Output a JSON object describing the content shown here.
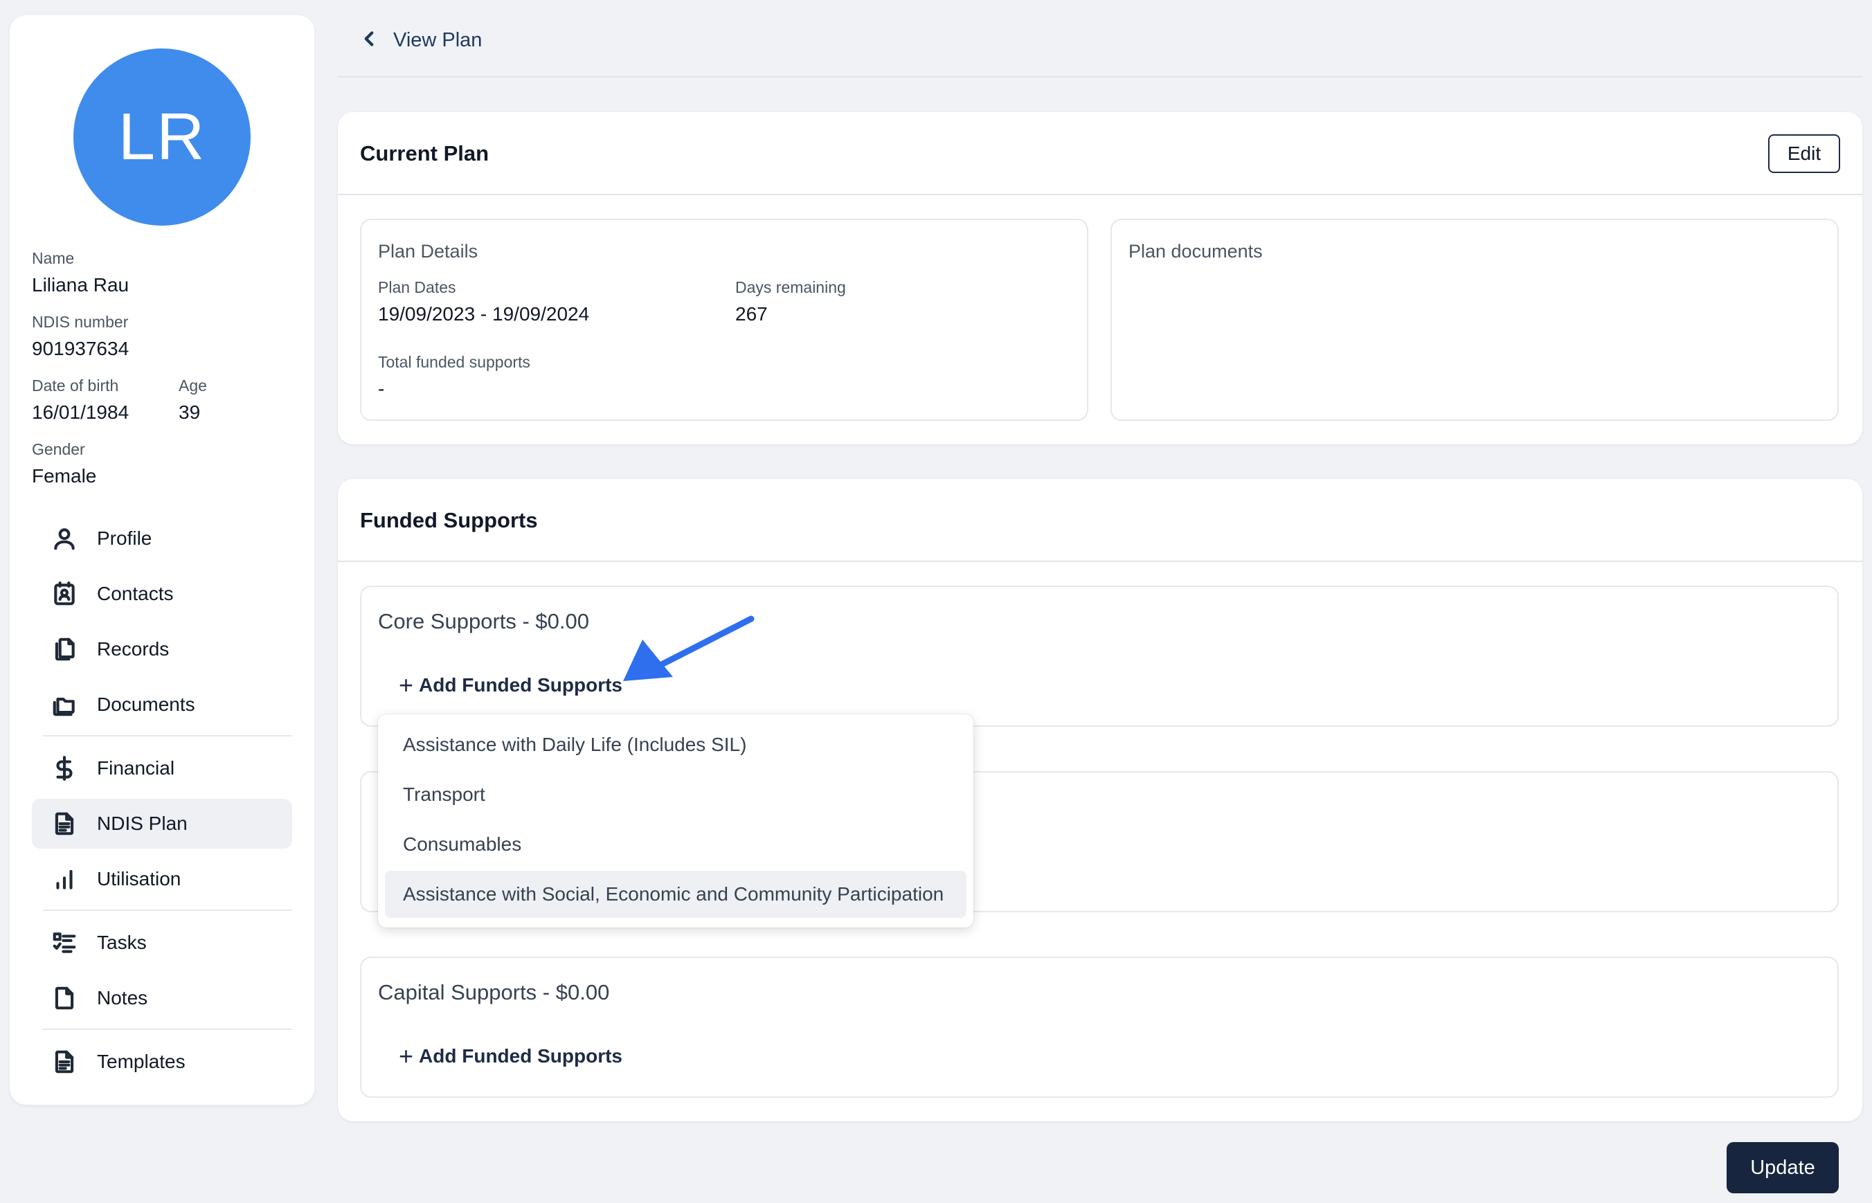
{
  "profile": {
    "initials": "LR",
    "avatar_color": "#3f8cec",
    "name_label": "Name",
    "name": "Liliana Rau",
    "ndis_label": "NDIS number",
    "ndis_number": "901937634",
    "dob_label": "Date of birth",
    "dob": "16/01/1984",
    "age_label": "Age",
    "age": "39",
    "gender_label": "Gender",
    "gender": "Female"
  },
  "nav": {
    "items": [
      {
        "label": "Profile",
        "icon": "person-icon"
      },
      {
        "label": "Contacts",
        "icon": "contacts-icon"
      },
      {
        "label": "Records",
        "icon": "records-icon"
      },
      {
        "label": "Documents",
        "icon": "folder-icon"
      },
      {
        "label": "Financial",
        "icon": "dollar-icon"
      },
      {
        "label": "NDIS Plan",
        "icon": "document-icon",
        "active": true
      },
      {
        "label": "Utilisation",
        "icon": "bar-chart-icon"
      },
      {
        "label": "Tasks",
        "icon": "checklist-icon"
      },
      {
        "label": "Notes",
        "icon": "note-icon"
      },
      {
        "label": "Templates",
        "icon": "template-icon"
      }
    ]
  },
  "header": {
    "back_label": "View Plan"
  },
  "current_plan": {
    "title": "Current Plan",
    "edit_label": "Edit",
    "details": {
      "title": "Plan Details",
      "dates_label": "Plan Dates",
      "dates": "19/09/2023 - 19/09/2024",
      "days_label": "Days remaining",
      "days": "267",
      "total_label": "Total funded supports",
      "total": "-"
    },
    "documents_title": "Plan documents"
  },
  "funded_supports": {
    "title": "Funded Supports",
    "core_title": "Core Supports - $0.00",
    "capital_title": "Capital Supports - $0.00",
    "add_label": "Add Funded Supports",
    "dropdown_options": [
      "Assistance with Daily Life (Includes SIL)",
      "Transport",
      "Consumables",
      "Assistance with Social, Economic and Community Participation"
    ]
  },
  "update_label": "Update",
  "colors": {
    "primary": "#17253f",
    "arrow": "#2f6fee"
  }
}
